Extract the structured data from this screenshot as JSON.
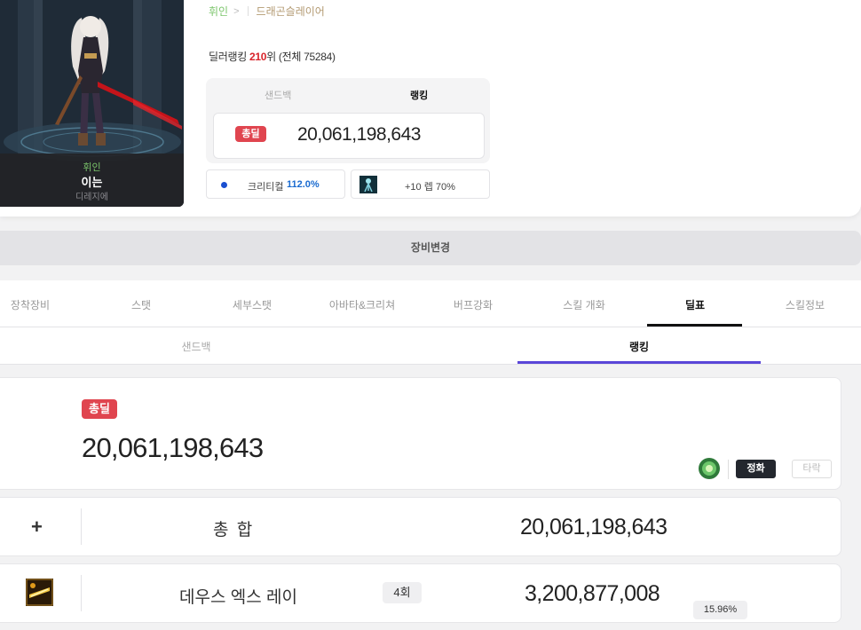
{
  "character": {
    "class": "휘인",
    "name": "이는",
    "guild": "디레지에"
  },
  "breadcrumb": {
    "class": "휘인",
    "job": "드래곤슬레이어"
  },
  "ranking": {
    "prefix": "딜러랭킹",
    "rank": "210",
    "suffix": "위 (전체 75284)"
  },
  "mini_panel": {
    "tab_sandbag": "샌드백",
    "tab_ranking": "랭킹",
    "total_label": "총딜",
    "total_value": "20,061,198,643"
  },
  "stats": {
    "crit_label": "크리티컬",
    "crit_value": "112.0%",
    "buff_text": "+10 렙 70%"
  },
  "equip_change": "장비변경",
  "main_tabs": [
    {
      "label": "장착장비"
    },
    {
      "label": "스탯"
    },
    {
      "label": "세부스탯"
    },
    {
      "label": "아바타&크리쳐"
    },
    {
      "label": "버프강화"
    },
    {
      "label": "스킬 개화"
    },
    {
      "label": "딜표"
    },
    {
      "label": "스킬정보"
    }
  ],
  "sub_tabs": {
    "sandbag": "샌드백",
    "ranking": "랭킹"
  },
  "total_card": {
    "label": "총딜",
    "value": "20,061,198,643",
    "toggle_on": "정화",
    "toggle_off": "타락"
  },
  "rows": {
    "sum": {
      "label": "총 합",
      "value": "20,061,198,643"
    },
    "skill": {
      "name": "데우스 엑스 레이",
      "count": "4회",
      "value": "3,200,877,008",
      "percent": "15.96%"
    }
  },
  "colors": {
    "accent_red": "#e0454f",
    "rank_red": "#d8232a",
    "crit_blue": "#1a6bd0",
    "sub_underline": "#5a46d8",
    "class_green": "#7bc56b"
  }
}
